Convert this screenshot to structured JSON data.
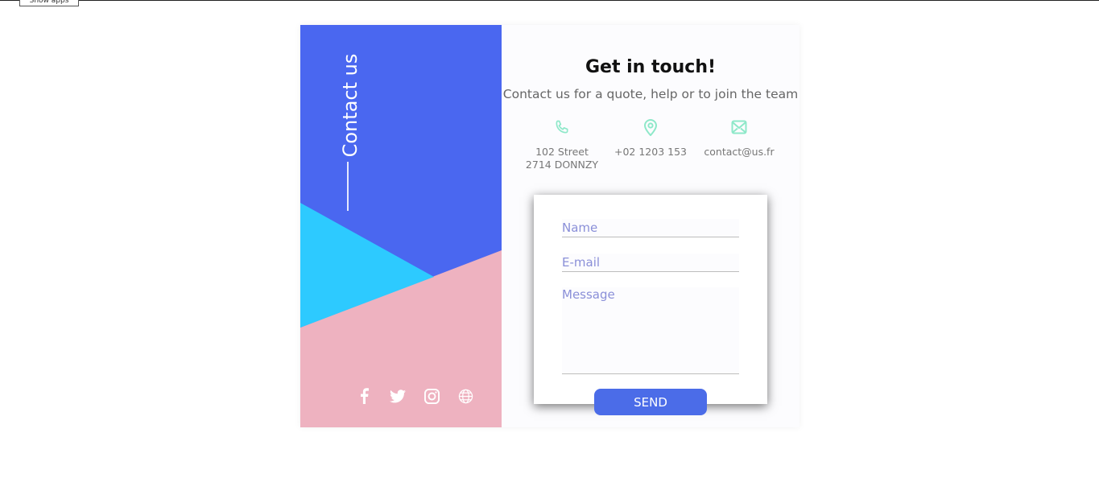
{
  "colors": {
    "blue": "#4a67f0",
    "cyan": "#2dcaff",
    "pink": "#eeb2c0",
    "accent_icon": "#8ee8c9",
    "button": "#4b6ce8"
  },
  "top_tab": "Show apps",
  "sidebar": {
    "title": "Contact us",
    "social": [
      {
        "icon": "facebook-icon"
      },
      {
        "icon": "twitter-icon"
      },
      {
        "icon": "instagram-icon"
      },
      {
        "icon": "globe-icon"
      }
    ]
  },
  "header": {
    "title": "Get in touch!",
    "subtitle": "Contact us for a quote, help or to join the team"
  },
  "info": {
    "address": {
      "icon": "phone-icon",
      "line1": "102 Street",
      "line2": "2714 DONNZY"
    },
    "phone": {
      "icon": "location-pin-icon",
      "text": "+02 1203 153"
    },
    "email": {
      "icon": "envelope-icon",
      "text": "contact@us.fr"
    }
  },
  "form": {
    "name_placeholder": "Name",
    "email_placeholder": "E-mail",
    "message_placeholder": "Message",
    "send_label": "SEND"
  }
}
